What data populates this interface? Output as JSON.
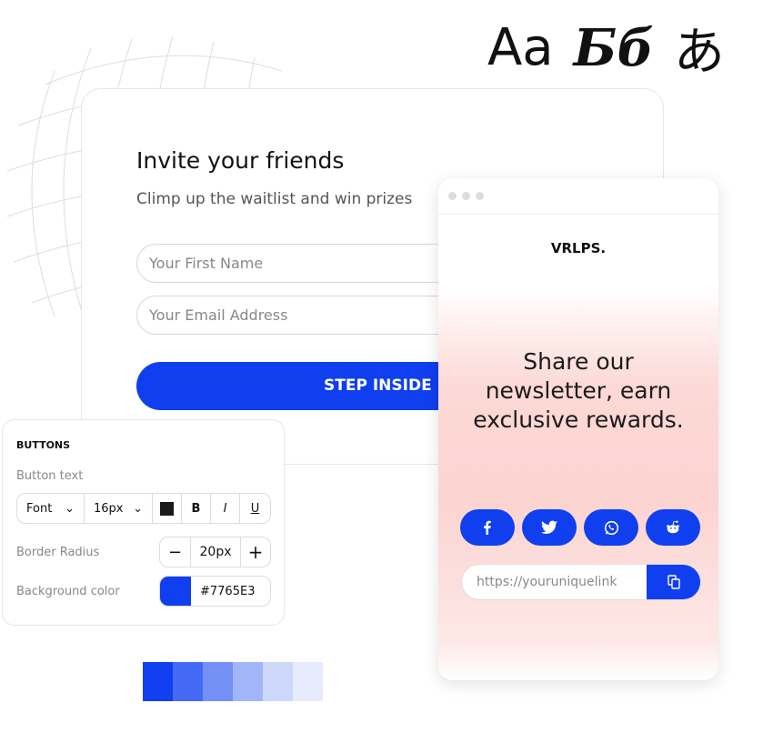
{
  "glyphs": {
    "latin": "Aa",
    "cyrillic": "Бб",
    "japanese": "あ"
  },
  "invite": {
    "title": "Invite your friends",
    "subtitle": "Climp up the waitlist and win prizes",
    "first_name_placeholder": "Your First Name",
    "email_placeholder": "Your Email Address",
    "button": "STEP INSIDE"
  },
  "panel": {
    "title": "BUTTONS",
    "button_text_label": "Button text",
    "font": "Font",
    "size": "16px",
    "bold": "B",
    "italic": "I",
    "underline": "U",
    "border_radius_label": "Border Radius",
    "minus": "−",
    "radius": "20px",
    "plus": "+",
    "bg_label": "Background color",
    "bg_value": "#7765E3",
    "swatch_color": "#0f3fef",
    "text_color": "#1a1a1a"
  },
  "phone": {
    "logo": "VRLPS.",
    "headline_lines": [
      "Share our",
      "newsletter, earn",
      "exclusive rewards."
    ],
    "social": [
      "facebook-icon",
      "twitter-icon",
      "whatsapp-icon",
      "reddit-icon"
    ],
    "link_value": "https://youruniquelink"
  },
  "palette": [
    "#0f3fef",
    "#4469f4",
    "#7490f6",
    "#a3b5f9",
    "#cdd8fb",
    "#e6ebfd"
  ]
}
